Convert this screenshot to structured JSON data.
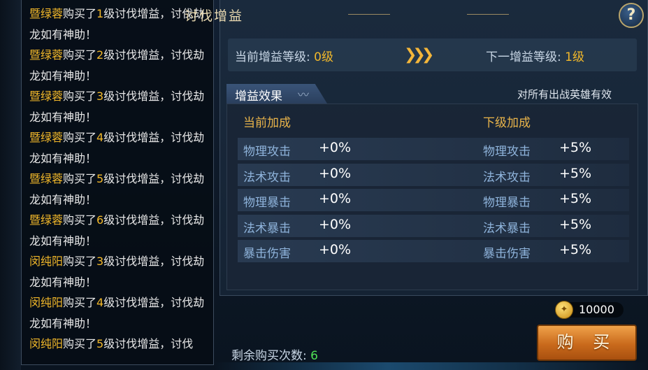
{
  "log": [
    {
      "name": "暨绿蓉",
      "pre": "购买了",
      "level": "1",
      "post": "级讨伐增益，讨伐劫龙如有神助！"
    },
    {
      "name": "暨绿蓉",
      "pre": "购买了",
      "level": "2",
      "post": "级讨伐增益，讨伐劫龙如有神助！"
    },
    {
      "name": "暨绿蓉",
      "pre": "购买了",
      "level": "3",
      "post": "级讨伐增益，讨伐劫龙如有神助！"
    },
    {
      "name": "暨绿蓉",
      "pre": "购买了",
      "level": "4",
      "post": "级讨伐增益，讨伐劫龙如有神助！"
    },
    {
      "name": "暨绿蓉",
      "pre": "购买了",
      "level": "5",
      "post": "级讨伐增益，讨伐劫龙如有神助！"
    },
    {
      "name": "暨绿蓉",
      "pre": "购买了",
      "level": "6",
      "post": "级讨伐增益，讨伐劫龙如有神助！"
    },
    {
      "name": "闵纯阳",
      "pre": "购买了",
      "level": "3",
      "post": "级讨伐增益，讨伐劫龙如有神助！"
    },
    {
      "name": "闵纯阳",
      "pre": "购买了",
      "level": "4",
      "post": "级讨伐增益，讨伐劫龙如有神助！"
    },
    {
      "name": "闵纯阳",
      "pre": "购买了",
      "level": "5",
      "post": "级讨伐增益，讨伐"
    }
  ],
  "panel": {
    "title": "讨伐增益",
    "help_label": "?",
    "current_level_label": "当前增益等级:",
    "current_level_value": "0级",
    "next_level_label": "下一增益等级:",
    "next_level_value": "1级",
    "effects_tab": "增益效果",
    "effects_note": "对所有出战英雄有效",
    "current_header": "当前加成",
    "next_header": "下级加成",
    "stats": [
      {
        "name": "物理攻击",
        "current": "+0%",
        "next": "+5%"
      },
      {
        "name": "法术攻击",
        "current": "+0%",
        "next": "+5%"
      },
      {
        "name": "物理暴击",
        "current": "+0%",
        "next": "+5%"
      },
      {
        "name": "法术暴击",
        "current": "+0%",
        "next": "+5%"
      },
      {
        "name": "暴击伤害",
        "current": "+0%",
        "next": "+5%"
      }
    ]
  },
  "coins": "10000",
  "buy_label": "购 买",
  "remaining_label": "剩余购买次数:",
  "remaining_value": "6",
  "icons": {
    "help": "question-mark-icon",
    "arrows": "triple-chevron-right-icon",
    "coin": "gold-coin-icon",
    "tab": "wing-icon"
  },
  "colors": {
    "accent": "#f2b82a",
    "stat_name": "#8fb4dc",
    "remaining": "#4fdf55",
    "button": "#c96a1c"
  }
}
